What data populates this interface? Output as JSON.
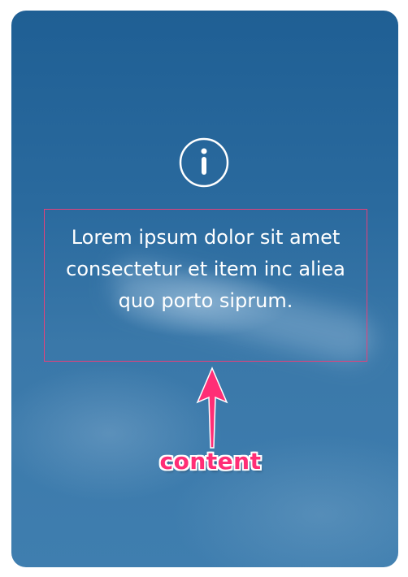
{
  "card": {
    "icon": "info-icon",
    "content_text": "Lorem ipsum dolor sit amet consectetur et item inc aliea quo porto siprum."
  },
  "annotation": {
    "label": "content",
    "color": "#ff2e76",
    "frame_color": "#e8407a",
    "arrow_icon": "arrow-up-icon"
  },
  "colors": {
    "card_background": "#2a6a9e",
    "text": "#ffffff"
  }
}
